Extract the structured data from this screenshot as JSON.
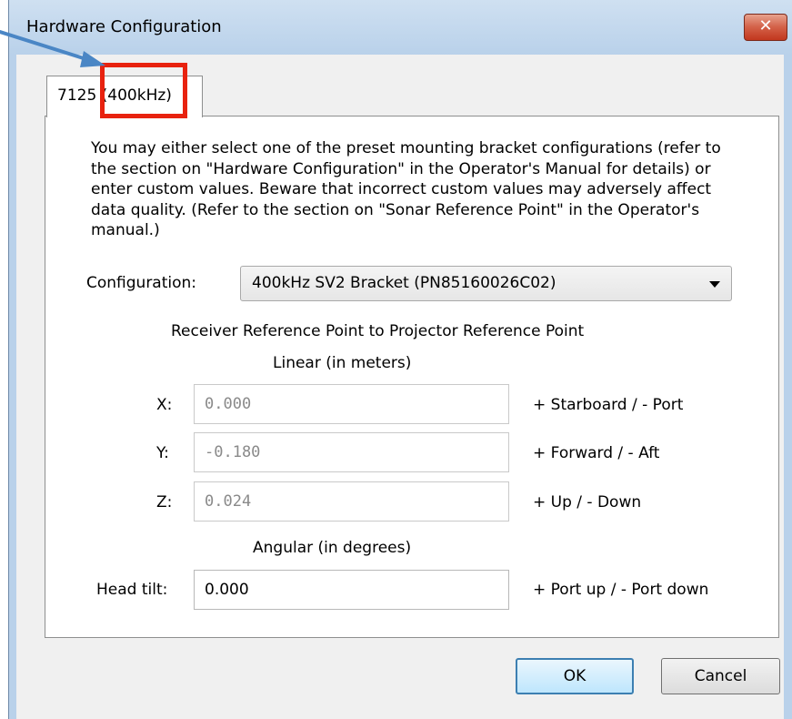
{
  "window": {
    "title": "Hardware Configuration",
    "close_glyph": "✕"
  },
  "tabs": [
    {
      "label": "7125 (400kHz)"
    }
  ],
  "description": "You may either select one of the preset mounting bracket configurations (refer to the section on \"Hardware Configuration\" in the Operator's Manual for details) or enter custom values. Beware that incorrect custom values may adversely affect data quality. (Refer to the section on \"Sonar Reference Point\" in the Operator's manual.)",
  "configuration": {
    "label": "Configuration:",
    "selected": "400kHz SV2 Bracket (PN85160026C02)"
  },
  "section_title": "Receiver Reference Point to Projector Reference Point",
  "linear": {
    "heading": "Linear (in meters)",
    "x": {
      "label": "X:",
      "value": "0.000",
      "hint": "+ Starboard / - Port"
    },
    "y": {
      "label": "Y:",
      "value": "-0.180",
      "hint": "+ Forward / - Aft"
    },
    "z": {
      "label": "Z:",
      "value": "0.024",
      "hint": "+ Up / - Down"
    }
  },
  "angular": {
    "heading": "Angular (in degrees)",
    "head_tilt": {
      "label": "Head tilt:",
      "value": "0.000",
      "hint": "+ Port up / - Port down"
    }
  },
  "buttons": {
    "ok": "OK",
    "cancel": "Cancel"
  },
  "colors": {
    "highlight": "#e8220f",
    "arrow": "#4a86c5",
    "title_bar": "#b9d1ea",
    "close_button": "#c2371e"
  }
}
